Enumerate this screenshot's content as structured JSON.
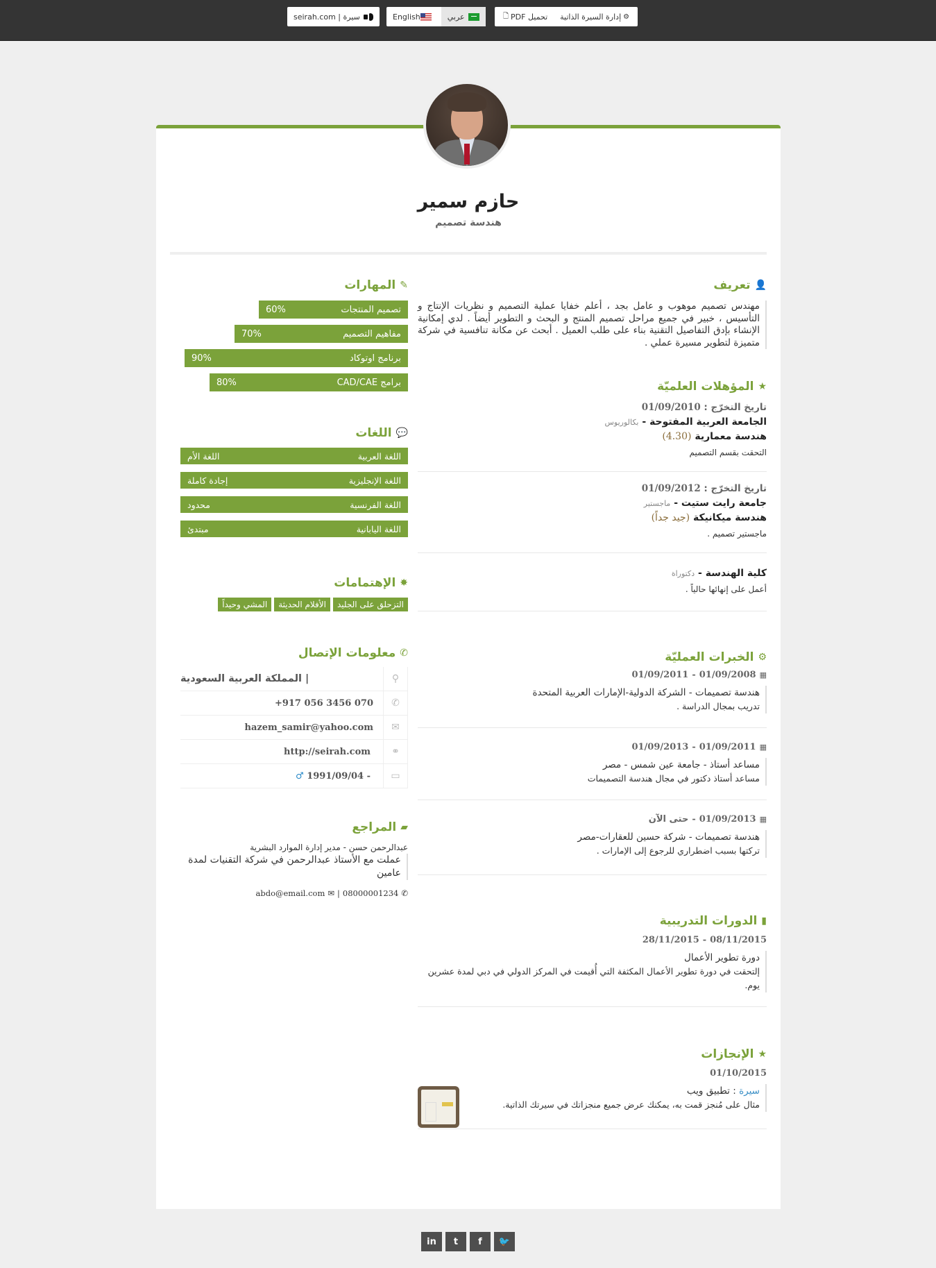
{
  "topbar": {
    "manage_label": "إدارة السيرة الذاتية",
    "pdf_label": "تحميل PDF",
    "lang_ar_label": "عربي",
    "lang_en_label": "English",
    "brand_label": "سيرة | seirah.com"
  },
  "profile": {
    "name": "حازم سمير",
    "title": "هندسة تصميم"
  },
  "about": {
    "heading": "تعريف",
    "text": "مهندس تصميم موهوب و عامل بجد ، أعلم خفايا عملية التصميم و نظريات الإنتاج و التأسيس ، خبير في جميع مراحل تصميم المنتج و البحث و التطوير أيضاً . لدي إمكانية الإنشاء بإدق التفاصيل التقنية بناء على طلب العميل . أبحث عن مكانة تنافسية في شركة متميزة لتطوير مسيرة عملي ."
  },
  "education": {
    "heading": "المؤهلات العلميّة",
    "grad_label": "تاريخ التخرّج :",
    "items": [
      {
        "date": "01/09/2010",
        "university": "الجامعة العربية المفتوحة",
        "degree": "بكالوريوس",
        "major": "هندسة معمارية",
        "grade": "(4.30)",
        "note": "التحقت بقسم التصميم"
      },
      {
        "date": "01/09/2012",
        "university": "جامعة رايت ستيت",
        "degree": "ماجستير",
        "major": "هندسة ميكانيكة",
        "grade": "(جيد جداً)",
        "note": "ماجستير تصميم ."
      },
      {
        "date": "",
        "university": "كلية الهندسة",
        "degree": "دكتوراة",
        "major": "",
        "grade": "",
        "note": "أعمل على إنهائها حالياً ."
      }
    ]
  },
  "experience": {
    "heading": "الخبرات العمليّة",
    "items": [
      {
        "from": "01/09/2008",
        "to": "01/09/2011",
        "role": "هندسة تصميمات - الشركة الدولية-الإمارات العربية المتحدة",
        "desc": "تدريب بمجال الدراسة ."
      },
      {
        "from": "01/09/2011",
        "to": "01/09/2013",
        "role": "مساعد أستاذ - جامعة عين شمس - مصر",
        "desc": "مساعد أستاذ دكتور في مجال هندسة التصميمات"
      },
      {
        "from": "01/09/2013",
        "to": "حتى الآن",
        "role": "هندسة تصميمات - شركة حسين للعقارات-مصر",
        "desc": "تركتها بسبب اضطراري للرجوع إلى الإمارات ."
      }
    ]
  },
  "courses": {
    "heading": "الدورات التدريبية",
    "items": [
      {
        "from": "08/11/2015",
        "to": "28/11/2015",
        "title": "دورة تطوير الأعمال",
        "desc": "إلتحقت في دورة تطوير الأعمال المكثفة التي أُقيمت في المركز الدولي في دبي لمدة عشرين يوم."
      }
    ]
  },
  "achievements": {
    "heading": "الإنجازات",
    "items": [
      {
        "date": "01/10/2015",
        "link": "سيرة",
        "title_rest": ": تطبيق ويب",
        "desc": "مثال على مُنجز قمت به، يمكنك عرض جميع منجزاتك في سيرتك الذاتية."
      }
    ]
  },
  "skills": {
    "heading": "المهارات",
    "items": [
      {
        "name": "تصميم المنتجات",
        "percent": 60,
        "label": "60%"
      },
      {
        "name": "مفاهيم التصميم",
        "percent": 70,
        "label": "70%"
      },
      {
        "name": "برنامج اوتوكاد",
        "percent": 90,
        "label": "90%"
      },
      {
        "name": "برامج CAD/CAE",
        "percent": 80,
        "label": "80%"
      }
    ]
  },
  "languages": {
    "heading": "اللغات",
    "items": [
      {
        "name": "اللغة العربية",
        "level": "اللغة الأم"
      },
      {
        "name": "اللغة الإنجليزية",
        "level": "إجادة كاملة"
      },
      {
        "name": "اللغة الفرنسية",
        "level": "محدود"
      },
      {
        "name": "اللغة اليابانية",
        "level": "مبتدئ"
      }
    ]
  },
  "interests": {
    "heading": "الإهتمامات",
    "items": [
      "التزحلق على الجليد",
      "الأفلام الحديثة",
      "المشي وحيداً"
    ]
  },
  "contact": {
    "heading": "معلومات الإتصال",
    "location": "| المملكة العربية السعودية",
    "phone": "+917 056 3456 070",
    "email": "hazem_samir@yahoo.com",
    "website": "http://seirah.com",
    "birth": "1991/09/04 -"
  },
  "references": {
    "heading": "المراجع",
    "items": [
      {
        "name": "عبدالرحمن حسن - مدير إدارة الموارد البشرية",
        "quote": "عملت مع الأستاذ عبدالرحمن في شركة التقنيات لمدة عامين",
        "phone": "08000001234",
        "email": "abdo@email.com"
      }
    ]
  },
  "social": [
    "in",
    "t",
    "f",
    "tw"
  ],
  "colors": {
    "accent": "#7ba23a",
    "topbar": "#343434",
    "background": "#efefef"
  }
}
